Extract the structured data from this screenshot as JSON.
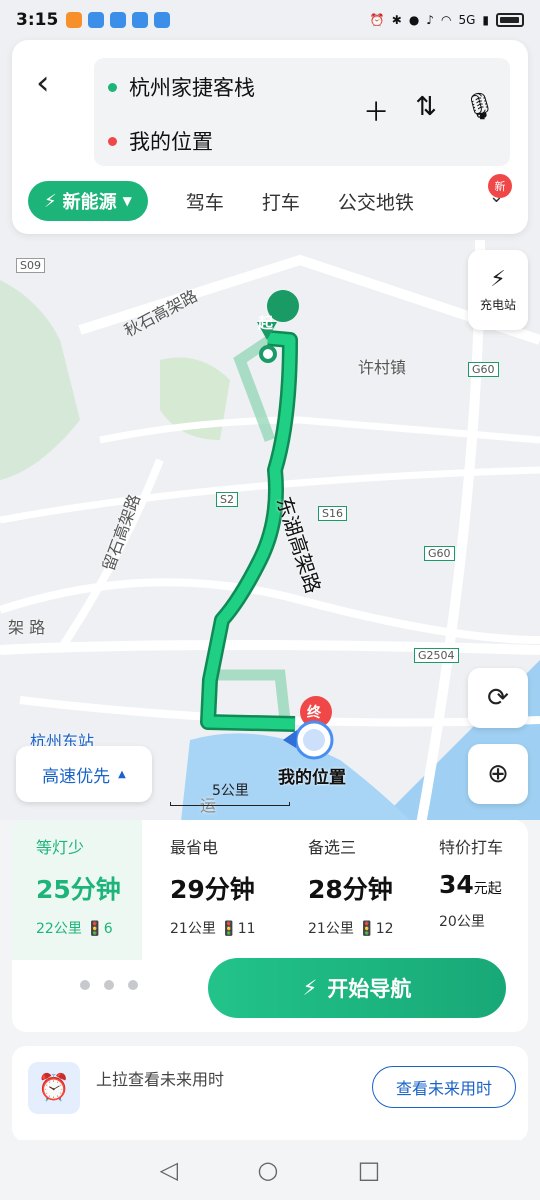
{
  "status": {
    "time": "3:15",
    "net": "5G"
  },
  "search": {
    "origin": "杭州家捷客栈",
    "destination": "我的位置"
  },
  "tabs": {
    "ev": "新能源",
    "drive": "驾车",
    "taxi": "打车",
    "transit": "公交地铁",
    "new_badge": "新"
  },
  "map": {
    "charging_label": "充电站",
    "route_start": "起",
    "route_end": "终",
    "my_location": "我的位置",
    "scale": "5公里",
    "route_pref": "高速优先",
    "labels": {
      "qiushi": "秋石高架路",
      "xucun": "许村镇",
      "donghu": "东湖高架路",
      "liushi": "留石高架路",
      "jia": "架 路",
      "station": "杭州东站",
      "s09": "S09",
      "g60a": "G60",
      "s2": "S2",
      "s16": "S16",
      "g60b": "G60",
      "g2504": "G2504",
      "road": "运"
    }
  },
  "routes": [
    {
      "label": "等灯少",
      "time": "25分钟",
      "km": "22公里",
      "lights": "6"
    },
    {
      "label": "最省电",
      "time": "29分钟",
      "km": "21公里",
      "lights": "11"
    },
    {
      "label": "备选三",
      "time": "28分钟",
      "km": "21公里",
      "lights": "12"
    },
    {
      "label": "特价打车",
      "time": "34",
      "time_unit": "元起",
      "km": "20公里"
    }
  ],
  "nav_button": "开始导航",
  "future": {
    "hint": "上拉查看未来用时",
    "button": "查看未来用时"
  },
  "colors": {
    "accent": "#1db47a",
    "blue": "#1a63c9",
    "end_pin": "#f04848"
  }
}
